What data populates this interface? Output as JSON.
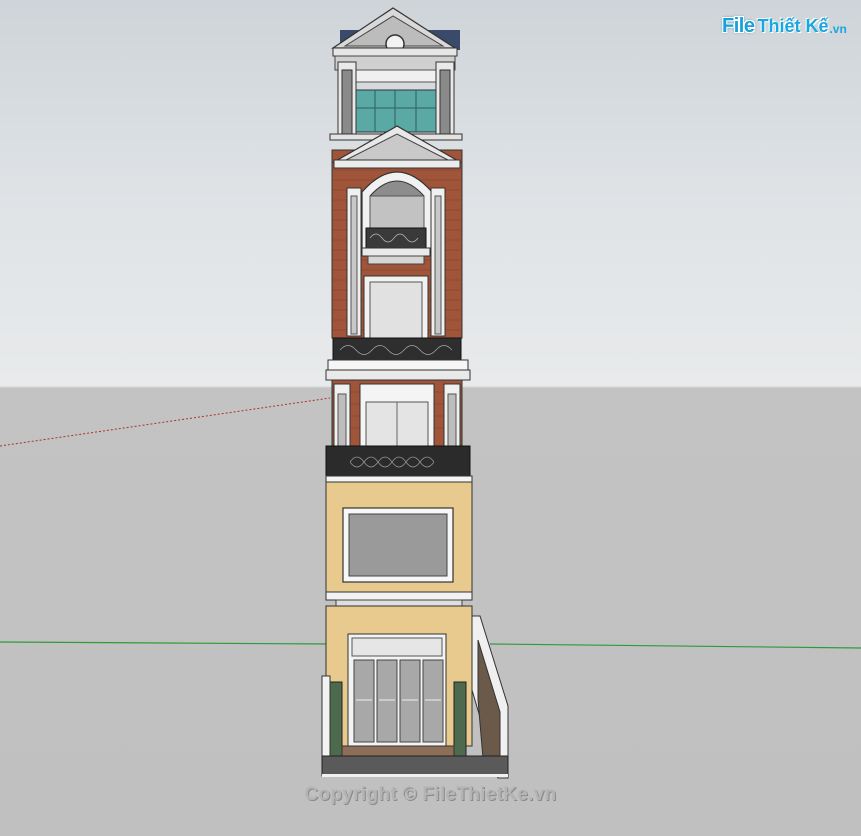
{
  "watermark": {
    "logo_file": "File",
    "logo_thietke": "Thiết Kế",
    "logo_vn": ".vn",
    "copyright": "Copyright © FileThietKe.vn"
  },
  "colors": {
    "sky_top": "#cfd4d9",
    "ground": "#c0c0c0",
    "brick": "#a0553a",
    "cream_wall": "#e8c98e",
    "trim_white": "#f4f4f4",
    "glass": "#5aa9a5",
    "window_grey": "#9a9a9a",
    "green_axis": "#2f9a3a",
    "red_axis": "#b03030",
    "brand_blue": "#1aa0d8"
  }
}
